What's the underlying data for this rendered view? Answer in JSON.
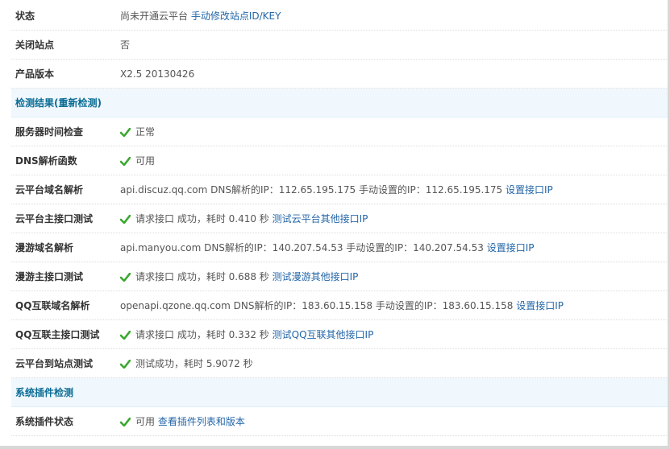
{
  "rows_top": {
    "status": {
      "label": "状态",
      "text": "尚未开通云平台",
      "link": "手动修改站点ID/KEY"
    },
    "closed": {
      "label": "关闭站点",
      "value": "否"
    },
    "version": {
      "label": "产品版本",
      "value": "X2.5 20130426"
    }
  },
  "section_check": {
    "title": "检测结果(重新检测)"
  },
  "checks": {
    "server_time": {
      "label": "服务器时间检查",
      "value": "正常"
    },
    "dns_func": {
      "label": "DNS解析函数",
      "value": "可用"
    },
    "cloud_domain": {
      "label": "云平台域名解析",
      "value": "api.discuz.qq.com DNS解析的IP：112.65.195.175 手动设置的IP：112.65.195.175",
      "link": "设置接口IP"
    },
    "cloud_main": {
      "label": "云平台主接口测试",
      "value": "请求接口 成功，耗时 0.410 秒",
      "link": "测试云平台其他接口IP"
    },
    "manyou_domain": {
      "label": "漫游域名解析",
      "value": "api.manyou.com DNS解析的IP：140.207.54.53 手动设置的IP：140.207.54.53",
      "link": "设置接口IP"
    },
    "manyou_main": {
      "label": "漫游主接口测试",
      "value": "请求接口 成功，耗时 0.688 秒",
      "link": "测试漫游其他接口IP"
    },
    "qq_domain": {
      "label": "QQ互联域名解析",
      "value": "openapi.qzone.qq.com DNS解析的IP：183.60.15.158 手动设置的IP：183.60.15.158",
      "link": "设置接口IP"
    },
    "qq_main": {
      "label": "QQ互联主接口测试",
      "value": "请求接口 成功，耗时 0.332 秒",
      "link": "测试QQ互联其他接口IP"
    },
    "cloud_to_site": {
      "label": "云平台到站点测试",
      "value": "测试成功，耗时 5.9072 秒"
    }
  },
  "section_plugin": {
    "title": "系统插件检测"
  },
  "plugin": {
    "status": {
      "label": "系统插件状态",
      "value": "可用",
      "link": "查看插件列表和版本"
    }
  },
  "icons": {
    "check": "green-check-icon"
  },
  "colors": {
    "link": "#2366a8",
    "section_bg": "#f0f7fd",
    "section_title": "#0a6c94",
    "check": "#3aa830"
  }
}
